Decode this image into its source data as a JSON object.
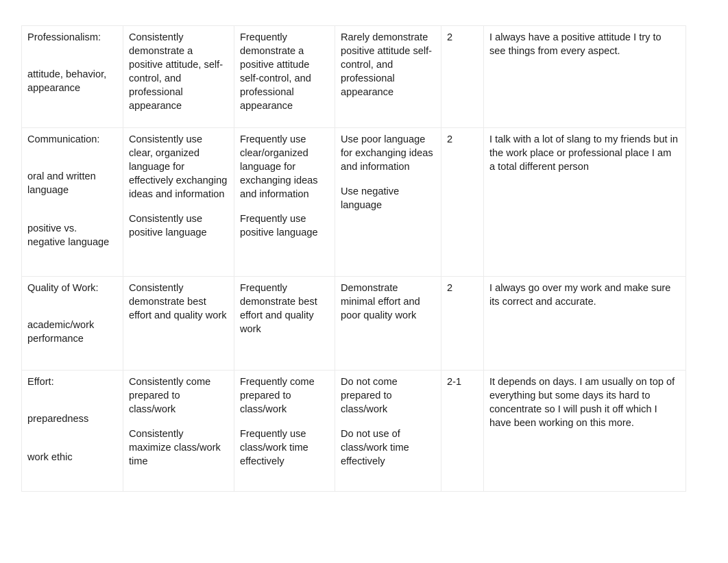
{
  "document": {
    "type": "rubric-table",
    "columns": [
      "criterion",
      "level_exemplary",
      "level_proficient",
      "level_developing",
      "score",
      "comment"
    ],
    "rows": [
      {
        "criterion_title": "Professionalism:",
        "criterion_sub": "attitude, behavior, appearance",
        "criterion_sub2": "",
        "level_exemplary": [
          "Consistently demonstrate a positive attitude, self-control, and professional appearance"
        ],
        "level_proficient": [
          "Frequently demonstrate a positive attitude self-control, and professional appearance"
        ],
        "level_developing": [
          "Rarely demonstrate positive attitude self-control, and professional appearance"
        ],
        "score": "2",
        "comment": "I always have a positive attitude I try to see things from every aspect."
      },
      {
        "criterion_title": "Communication:",
        "criterion_sub": "oral and written language",
        "criterion_sub2": "positive vs. negative language",
        "level_exemplary": [
          "Consistently use clear, organized language for effectively exchanging ideas and information",
          "Consistently use positive language"
        ],
        "level_proficient": [
          "Frequently use clear/organized language for exchanging ideas and information",
          "Frequently use positive language"
        ],
        "level_developing": [
          "Use poor language for exchanging ideas and information",
          "Use negative language"
        ],
        "score": "2",
        "comment": "I talk with a lot of slang to my friends but in the work place or professional place I am a total different person"
      },
      {
        "criterion_title": "Quality of Work:",
        "criterion_sub": "academic/work performance",
        "criterion_sub2": "",
        "level_exemplary": [
          "Consistently demonstrate best effort and quality work"
        ],
        "level_proficient": [
          "Frequently demonstrate best effort and quality work"
        ],
        "level_developing": [
          "Demonstrate minimal effort and poor quality work"
        ],
        "score": "2",
        "comment": "I always go over my work and make sure its correct and accurate."
      },
      {
        "criterion_title": "Effort:",
        "criterion_sub": "preparedness",
        "criterion_sub2": "work ethic",
        "level_exemplary": [
          "Consistently come prepared to class/work",
          "Consistently maximize class/work time"
        ],
        "level_proficient": [
          "Frequently come prepared to class/work",
          "Frequently use class/work time effectively"
        ],
        "level_developing": [
          "Do not come prepared to class/work",
          "Do not use of class/work time effectively"
        ],
        "score": "2-1",
        "comment": "It depends on days. I am usually on top of everything but some days its hard to concentrate so I will push it off which I have been working on this more."
      }
    ]
  },
  "style": {
    "border_color": "#ebebeb",
    "text_color": "#1c1c1c",
    "background": "#ffffff"
  }
}
